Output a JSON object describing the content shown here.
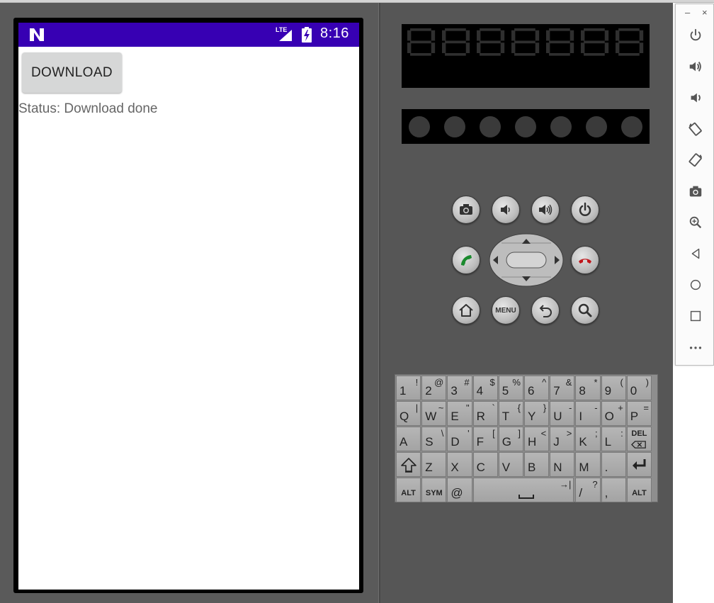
{
  "device": {
    "status_bar": {
      "time": "8:16",
      "network_type": "LTE",
      "color": "#3700b3",
      "icons": [
        "android-n-logo-icon",
        "cellular-signal-icon",
        "battery-charging-icon"
      ]
    },
    "app": {
      "download_button_label": "DOWNLOAD",
      "status_text": "Status: Download done"
    }
  },
  "hardware_buttons": {
    "row1": [
      "camera-icon",
      "volume-down-icon",
      "volume-up-icon",
      "power-icon"
    ],
    "row2": [
      "call-icon",
      "dpad",
      "end-call-icon"
    ],
    "row3": [
      "home-icon",
      "menu",
      "back-icon",
      "search-icon"
    ],
    "menu_label": "MENU"
  },
  "keyboard": {
    "rows": [
      [
        {
          "main": "1",
          "sup": "!"
        },
        {
          "main": "2",
          "sup": "@"
        },
        {
          "main": "3",
          "sup": "#"
        },
        {
          "main": "4",
          "sup": "$"
        },
        {
          "main": "5",
          "sup": "%"
        },
        {
          "main": "6",
          "sup": "^"
        },
        {
          "main": "7",
          "sup": "&"
        },
        {
          "main": "8",
          "sup": "*"
        },
        {
          "main": "9",
          "sup": "("
        },
        {
          "main": "0",
          "sup": ")"
        }
      ],
      [
        {
          "main": "Q",
          "sup": "|"
        },
        {
          "main": "W",
          "sup": "~"
        },
        {
          "main": "E",
          "sup": "\""
        },
        {
          "main": "R",
          "sup": "`"
        },
        {
          "main": "T",
          "sup": "{"
        },
        {
          "main": "Y",
          "sup": "}"
        },
        {
          "main": "U",
          "sup": "-"
        },
        {
          "main": "I",
          "sup": "-"
        },
        {
          "main": "O",
          "sup": "+"
        },
        {
          "main": "P",
          "sup": "="
        }
      ],
      [
        {
          "main": "A",
          "sup": ""
        },
        {
          "main": "S",
          "sup": "\\"
        },
        {
          "main": "D",
          "sup": "'"
        },
        {
          "main": "F",
          "sup": "["
        },
        {
          "main": "G",
          "sup": "]"
        },
        {
          "main": "H",
          "sup": "<"
        },
        {
          "main": "J",
          "sup": ">"
        },
        {
          "main": "K",
          "sup": ";"
        },
        {
          "main": "L",
          "sup": ":"
        },
        {
          "main": "DEL",
          "sup": ""
        }
      ],
      [
        {
          "main": "shift",
          "sup": ""
        },
        {
          "main": "Z",
          "sup": ""
        },
        {
          "main": "X",
          "sup": ""
        },
        {
          "main": "C",
          "sup": ""
        },
        {
          "main": "V",
          "sup": ""
        },
        {
          "main": "B",
          "sup": ""
        },
        {
          "main": "N",
          "sup": ""
        },
        {
          "main": "M",
          "sup": ""
        },
        {
          "main": ".",
          "sup": ""
        },
        {
          "main": "enter",
          "sup": ""
        }
      ]
    ],
    "bottom_row": {
      "alt_label": "ALT",
      "sym_label": "SYM",
      "at": "@",
      "space_tab": "→|",
      "slash": "/",
      "slash_sup": "?",
      "comma": ",",
      "alt_right_label": "ALT"
    },
    "del_label": "DEL"
  },
  "toolbar": {
    "window_controls": {
      "minimize": "–",
      "close": "×"
    },
    "buttons": [
      "power-icon",
      "volume-up-icon",
      "volume-down-icon",
      "rotate-left-icon",
      "rotate-right-icon",
      "screenshot-icon",
      "zoom-icon",
      "back-triangle-icon",
      "home-circle-icon",
      "overview-square-icon",
      "more-icon"
    ]
  }
}
